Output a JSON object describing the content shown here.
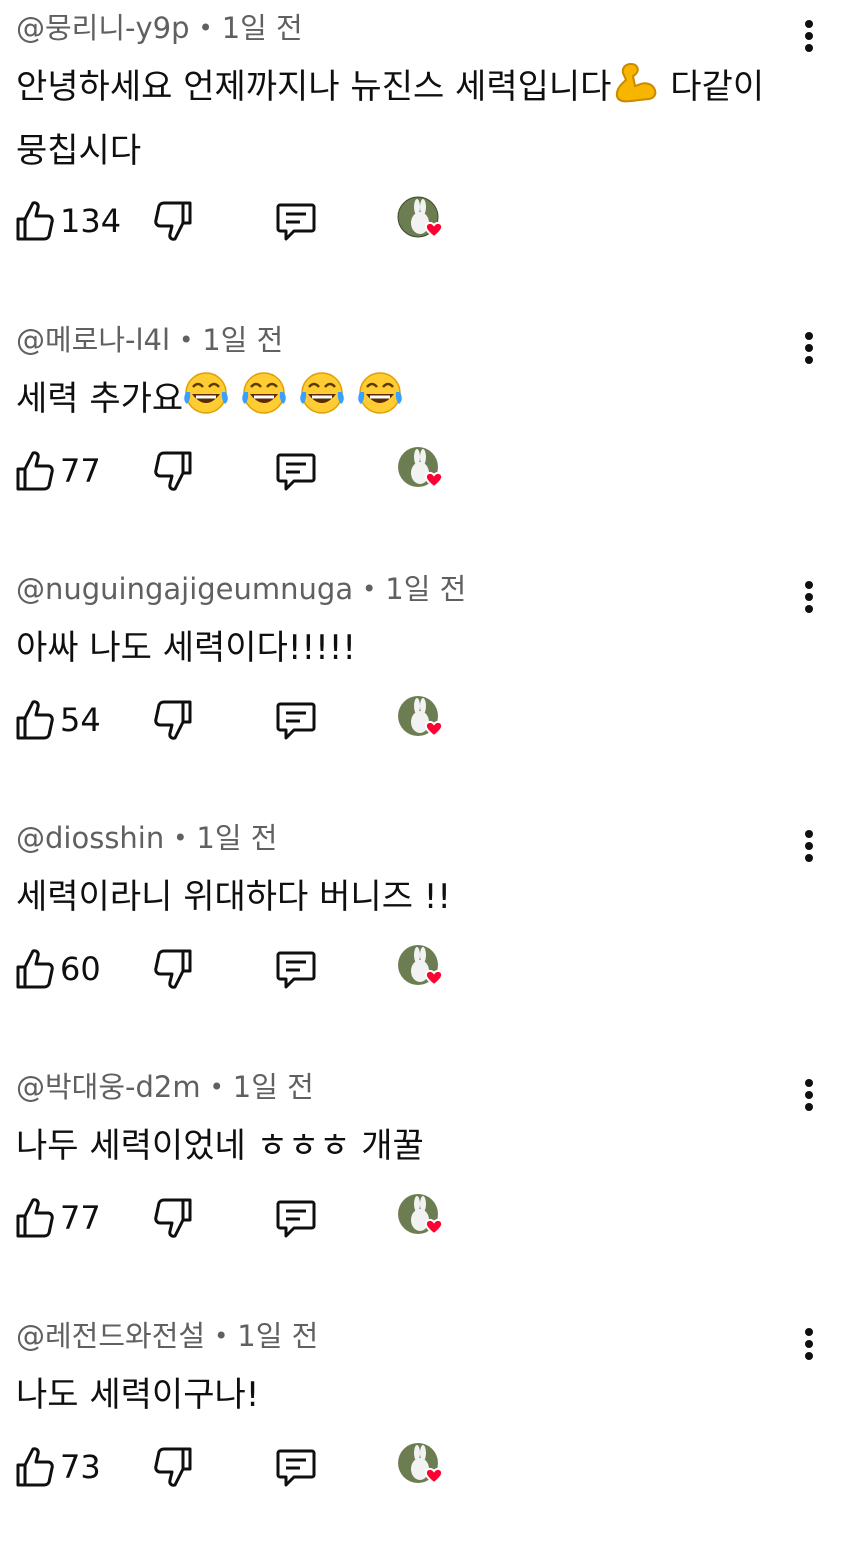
{
  "comments": [
    {
      "author": "@뭉리니-y9p",
      "time": "1일 전",
      "text_before": "안녕하세요 언제까지나 뉴진스 세력입니다",
      "emoji": "muscle",
      "text_after": " 다같이 뭉칩시다",
      "likes": "134"
    },
    {
      "author": "@메로나-l4l",
      "time": "1일 전",
      "text_before": "세력 추가요",
      "emoji": "laugh-tears-x4",
      "text_after": "",
      "likes": "77"
    },
    {
      "author": "@nuguingajigeumnuga",
      "time": "1일 전",
      "text_before": "아싸 나도 세력이다!!!!!",
      "emoji": "",
      "text_after": "",
      "likes": "54"
    },
    {
      "author": "@diosshin",
      "time": "1일 전",
      "text_before": "세력이라니 위대하다 버니즈 !!",
      "emoji": "",
      "text_after": "",
      "likes": "60"
    },
    {
      "author": "@박대웅-d2m",
      "time": "1일 전",
      "text_before": "나두 세력이었네 ㅎㅎㅎ 개꿀",
      "emoji": "",
      "text_after": "",
      "likes": "77"
    },
    {
      "author": "@레전드와전설",
      "time": "1일 전",
      "text_before": "나도 세력이구나!",
      "emoji": "",
      "text_after": "",
      "likes": "73"
    }
  ],
  "icons": {
    "like": "thumbs-up-icon",
    "dislike": "thumbs-down-icon",
    "reply": "reply-comment-icon",
    "more": "more-vertical-icon",
    "creator_heart": "creator-heart-avatar-icon"
  },
  "colors": {
    "text": "#0f0f0f",
    "meta": "#606060",
    "heart": "#ff0033"
  }
}
